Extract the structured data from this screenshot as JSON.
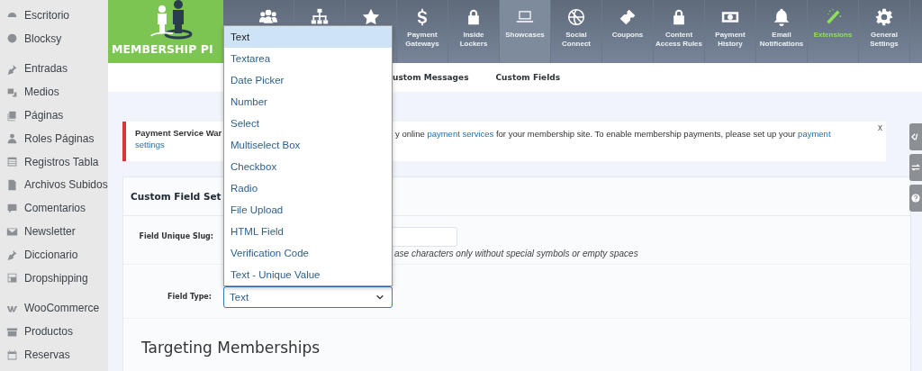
{
  "sidebar": {
    "groups": [
      [
        {
          "label": "Escritorio"
        },
        {
          "label": "Blocksy"
        }
      ],
      [
        {
          "label": "Entradas"
        },
        {
          "label": "Medios"
        },
        {
          "label": "Páginas"
        },
        {
          "label": "Roles Páginas"
        },
        {
          "label": "Registros Tabla"
        },
        {
          "label": "Archivos Subidos"
        },
        {
          "label": "Comentarios"
        },
        {
          "label": "Newsletter"
        },
        {
          "label": "Diccionario"
        },
        {
          "label": "Dropshipping"
        }
      ],
      [
        {
          "label": "WooCommerce"
        },
        {
          "label": "Productos"
        },
        {
          "label": "Reservas"
        }
      ]
    ]
  },
  "logo": {
    "text": "MEMBERSHIP PI"
  },
  "nav": [
    {
      "selected": false,
      "highlighted": false
    },
    {
      "selected": false,
      "highlighted": false
    },
    {
      "selected": false,
      "highlighted": false
    },
    {
      "label": "Payment Gateways",
      "selected": false,
      "highlighted": false
    },
    {
      "label": "Inside Lockers",
      "selected": false,
      "highlighted": false
    },
    {
      "label": "Showcases",
      "selected": true,
      "highlighted": false
    },
    {
      "label": "Social Connect",
      "selected": false,
      "highlighted": false
    },
    {
      "label": "Coupons",
      "selected": false,
      "highlighted": false
    },
    {
      "label": "Content Access Rules",
      "selected": false,
      "highlighted": false
    },
    {
      "label": "Payment History",
      "selected": false,
      "highlighted": false
    },
    {
      "label": "Email Notifications",
      "selected": false,
      "highlighted": false
    },
    {
      "label": "Extensions",
      "selected": false,
      "highlighted": true
    },
    {
      "label": "General Settings",
      "selected": false,
      "highlighted": false
    }
  ],
  "subtabs": [
    "ustom Messages",
    "Custom Fields"
  ],
  "notice": {
    "title": "Payment Service War",
    "settings_link": "settings",
    "text_parts": [
      {
        "text": "y online ",
        "link": false
      },
      {
        "text": "payment services",
        "link": true
      },
      {
        "text": " for your membership site. To enable membership payments, please set up your ",
        "link": false
      },
      {
        "text": "payment",
        "link": true
      }
    ],
    "close": "x"
  },
  "panel": {
    "title": "Custom Field Set",
    "slug": {
      "label": "Field Unique Slug:",
      "hint": "ase characters only without special symbols or empty spaces"
    },
    "field_type": {
      "label": "Field Type:",
      "value": "Text"
    }
  },
  "dropdown": [
    {
      "label": "Text",
      "selected": true
    },
    {
      "label": "Textarea",
      "selected": false
    },
    {
      "label": "Date Picker",
      "selected": false
    },
    {
      "label": "Number",
      "selected": false
    },
    {
      "label": "Select",
      "selected": false
    },
    {
      "label": "Multiselect Box",
      "selected": false
    },
    {
      "label": "Checkbox",
      "selected": false
    },
    {
      "label": "Radio",
      "selected": false
    },
    {
      "label": "File Upload",
      "selected": false
    },
    {
      "label": "HTML Field",
      "selected": false
    },
    {
      "label": "Verification Code",
      "selected": false
    },
    {
      "label": "Text - Unique Value",
      "selected": false
    }
  ],
  "targeting": {
    "title": "Targeting Memberships"
  }
}
